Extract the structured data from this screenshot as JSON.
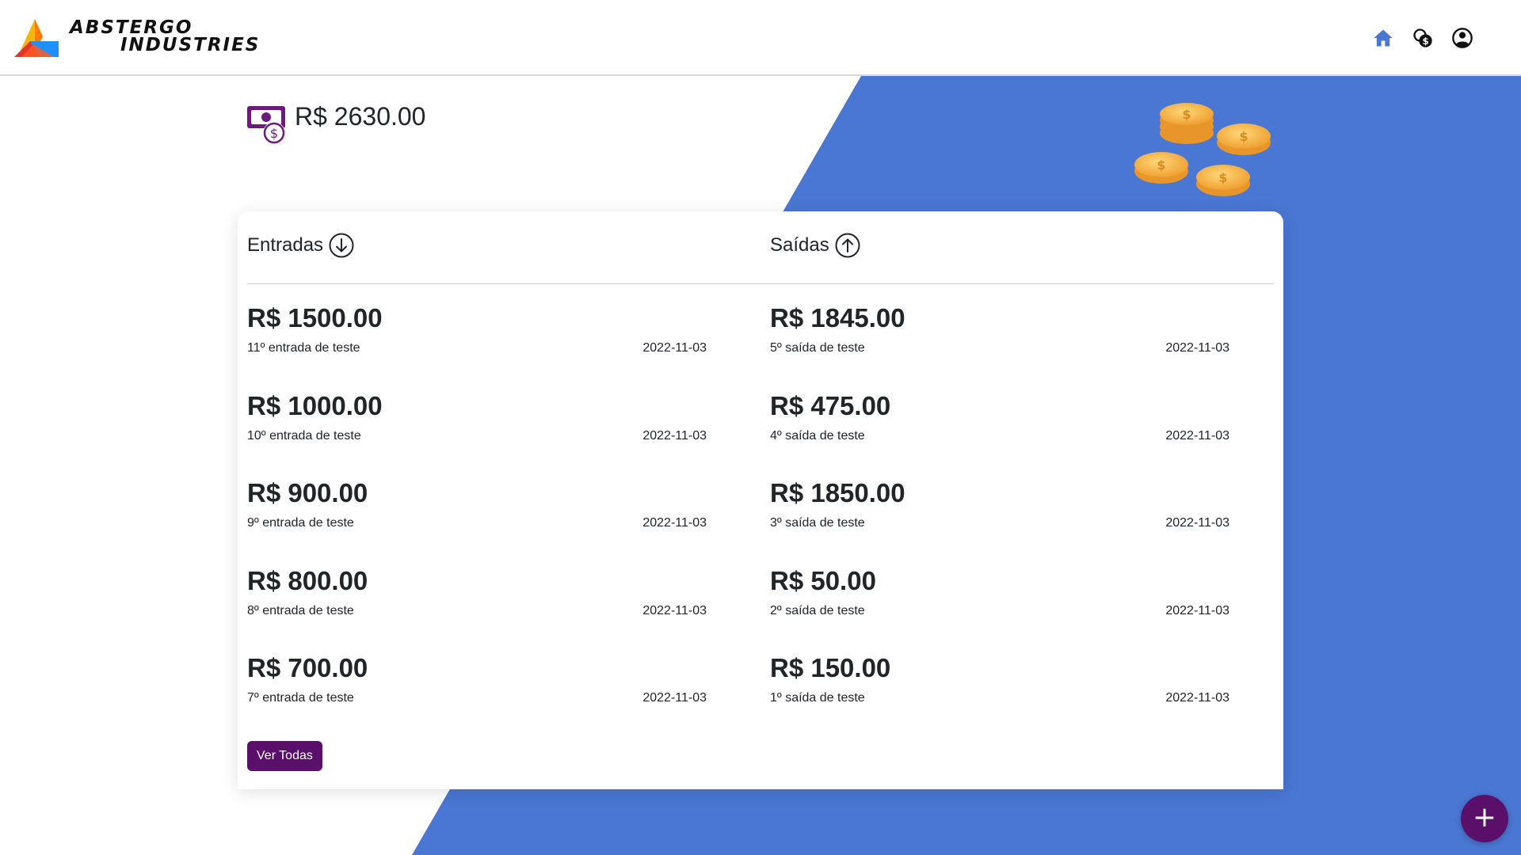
{
  "brand": {
    "line1": "ABSTERGO",
    "line2": "INDUSTRIES"
  },
  "nav": {
    "icons": [
      "home-icon",
      "dollar-coins-icon",
      "user-account-icon"
    ],
    "active_color": "#4a77d4"
  },
  "balance": {
    "value": "R$ 2630.00",
    "icon": "money-bill-dollar-icon",
    "icon_color": "#6b1a7e"
  },
  "colors": {
    "accent": "#5a0f6b",
    "background_shape": "#4a77d4"
  },
  "entradas": {
    "title": "Entradas",
    "icon": "arrow-down-circle-icon",
    "items": [
      {
        "amount": "R$ 1500.00",
        "description": "11º entrada de teste",
        "date": "2022-11-03"
      },
      {
        "amount": "R$ 1000.00",
        "description": "10º entrada de teste",
        "date": "2022-11-03"
      },
      {
        "amount": "R$ 900.00",
        "description": "9º entrada de teste",
        "date": "2022-11-03"
      },
      {
        "amount": "R$ 800.00",
        "description": "8º entrada de teste",
        "date": "2022-11-03"
      },
      {
        "amount": "R$ 700.00",
        "description": "7º entrada de teste",
        "date": "2022-11-03"
      }
    ]
  },
  "saidas": {
    "title": "Saídas",
    "icon": "arrow-up-circle-icon",
    "items": [
      {
        "amount": "R$ 1845.00",
        "description": "5º saída de teste",
        "date": "2022-11-03"
      },
      {
        "amount": "R$ 475.00",
        "description": "4º saída de teste",
        "date": "2022-11-03"
      },
      {
        "amount": "R$ 1850.00",
        "description": "3º saída de teste",
        "date": "2022-11-03"
      },
      {
        "amount": "R$ 50.00",
        "description": "2º saída de teste",
        "date": "2022-11-03"
      },
      {
        "amount": "R$ 150.00",
        "description": "1º saída de teste",
        "date": "2022-11-03"
      }
    ]
  },
  "actions": {
    "view_all_label": "Ver Todas",
    "fab_label": "+"
  }
}
